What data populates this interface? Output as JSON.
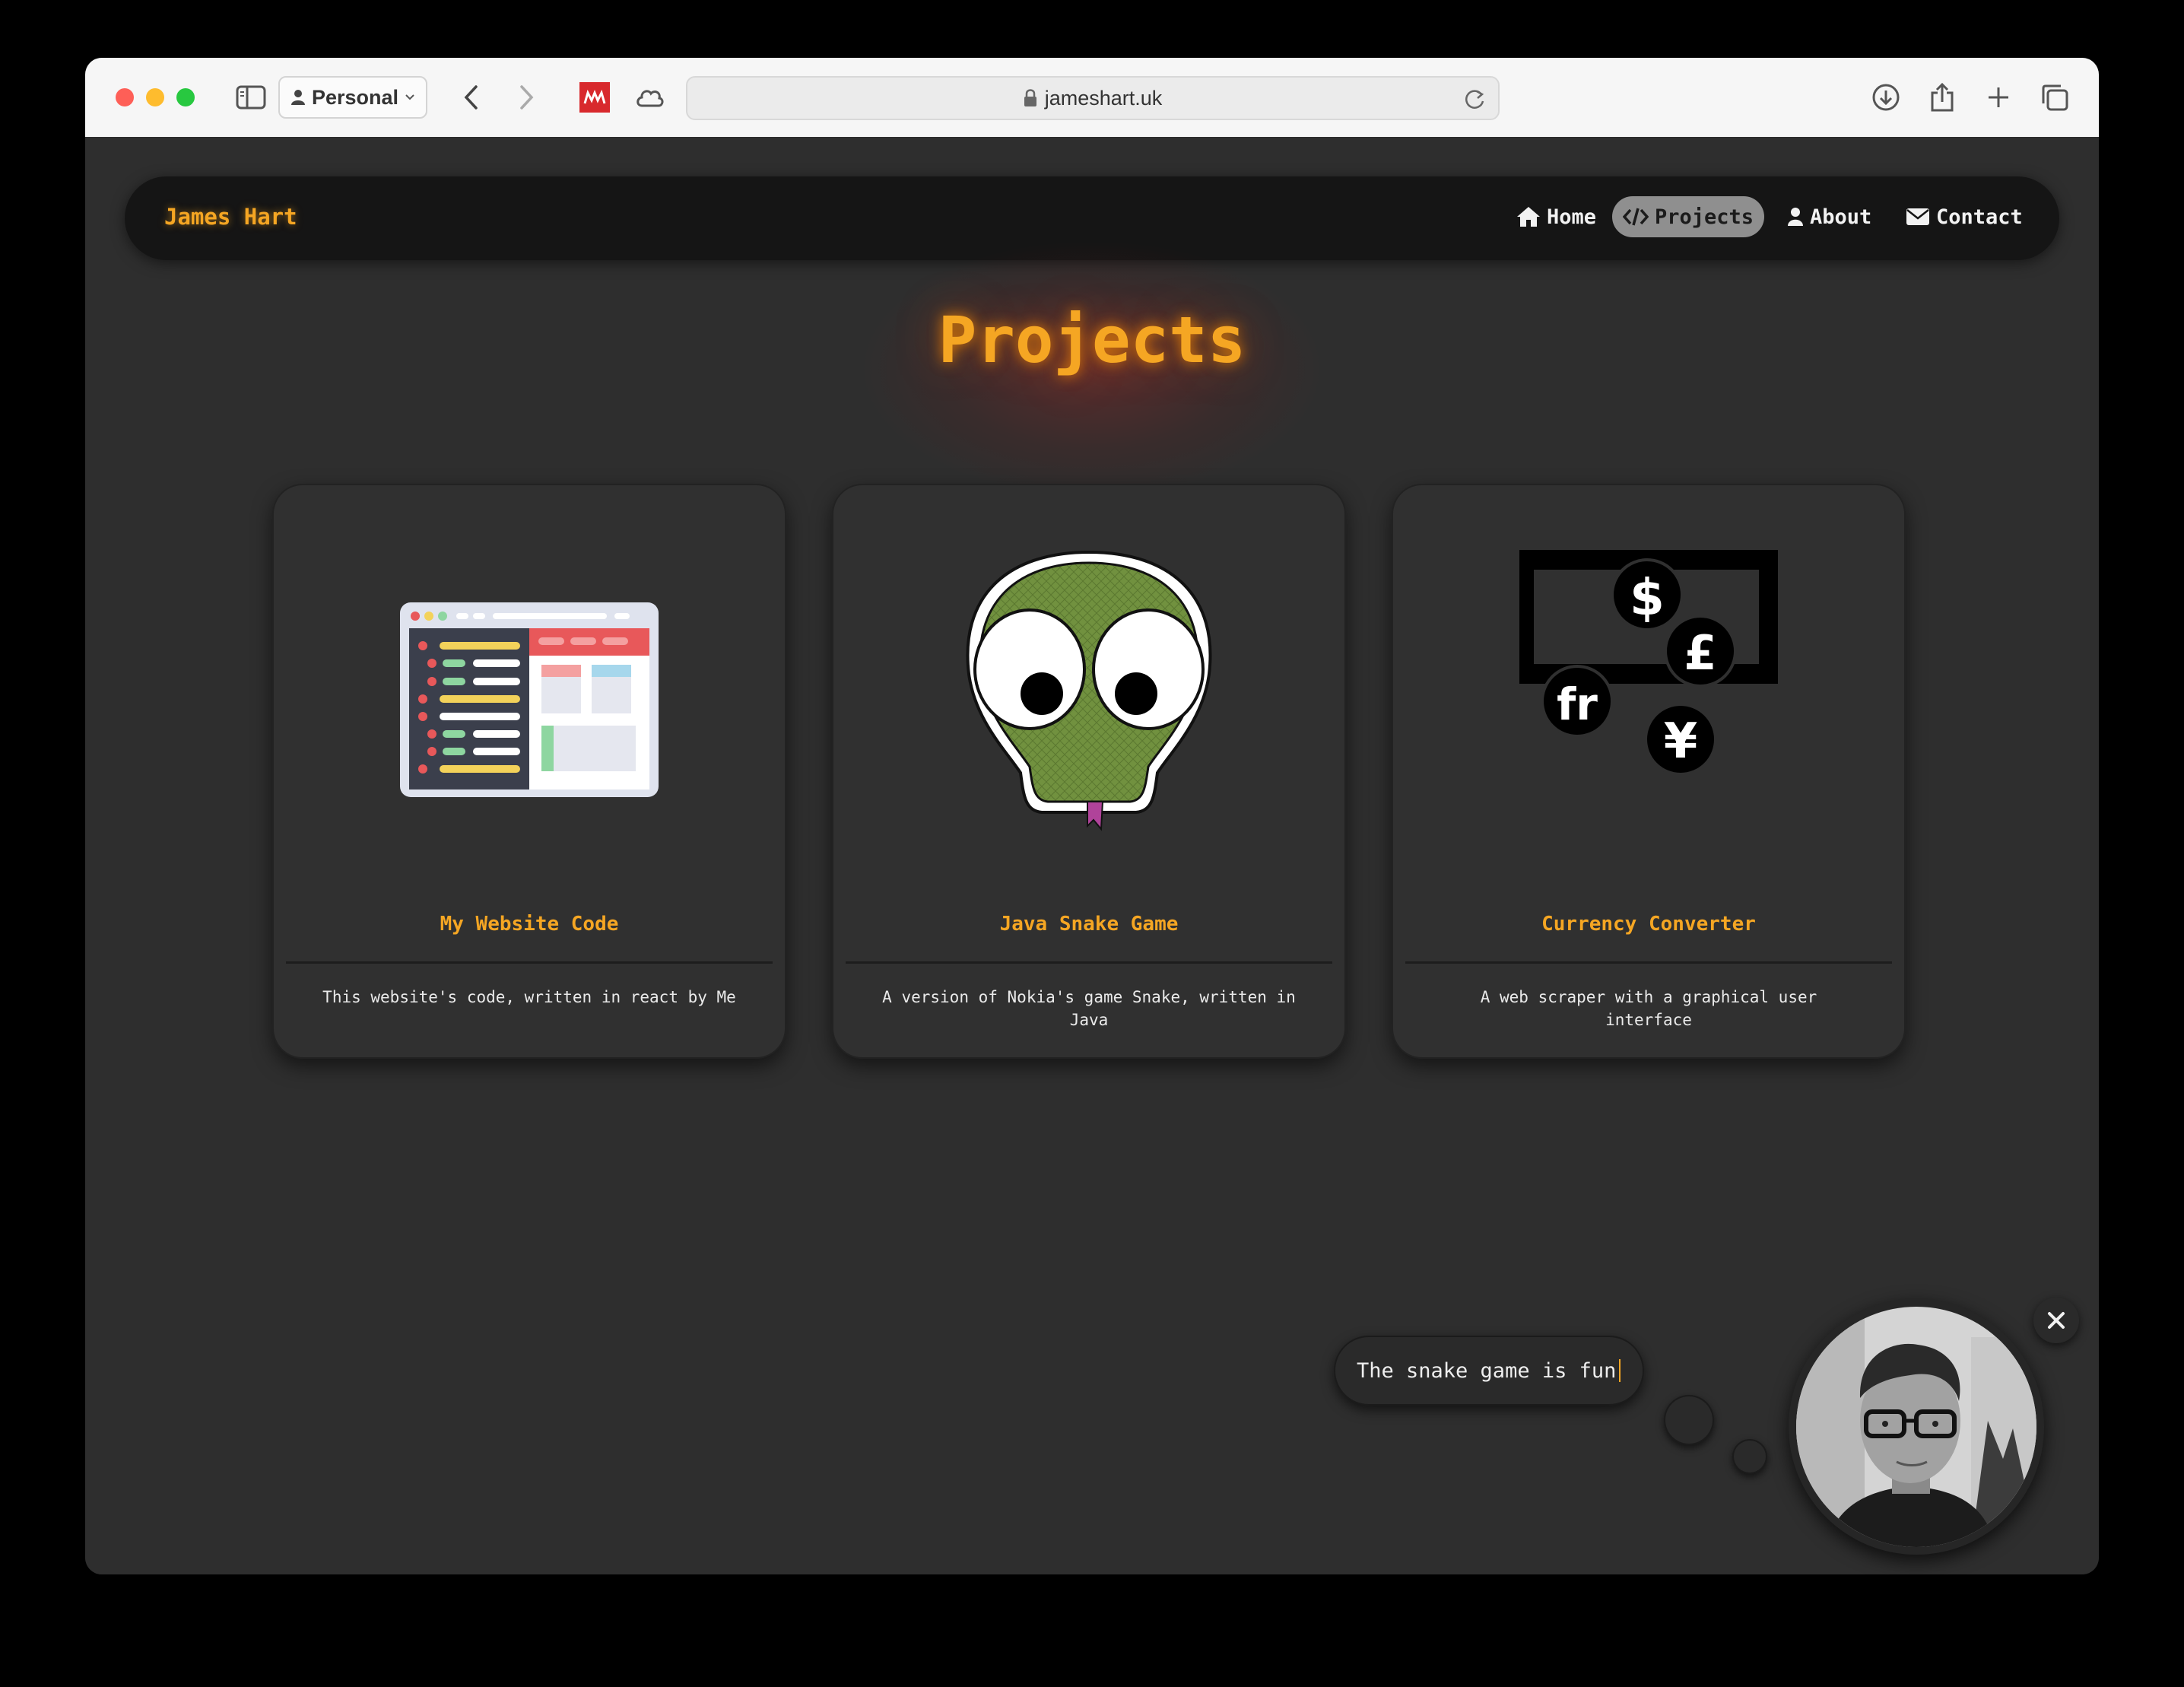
{
  "browser": {
    "profile_label": "Personal",
    "url": "jameshart.uk"
  },
  "nav": {
    "brand": "James Hart",
    "items": [
      {
        "label": "Home",
        "icon": "home-icon"
      },
      {
        "label": "Projects",
        "icon": "code-icon",
        "active": true
      },
      {
        "label": "About",
        "icon": "user-icon"
      },
      {
        "label": "Contact",
        "icon": "envelope-icon"
      }
    ]
  },
  "page": {
    "heading": "Projects"
  },
  "projects": [
    {
      "title": "My Website Code",
      "description": "This website's code, written in react by Me",
      "image": "code-editor-illustration"
    },
    {
      "title": "Java Snake Game",
      "description": "A version of Nokia's game Snake, written in Java",
      "image": "cartoon-snake-head"
    },
    {
      "title": "Currency Converter",
      "description": "A web scraper with a graphical user interface",
      "image": "currency-symbols-illustration"
    }
  ],
  "chat": {
    "message": "The snake game is fun",
    "avatar": "profile-photo"
  },
  "colors": {
    "accent": "#f5a623",
    "page_bg": "#2e2e2e",
    "navbar_bg": "#151515",
    "active_pill": "#8f8f8f"
  }
}
